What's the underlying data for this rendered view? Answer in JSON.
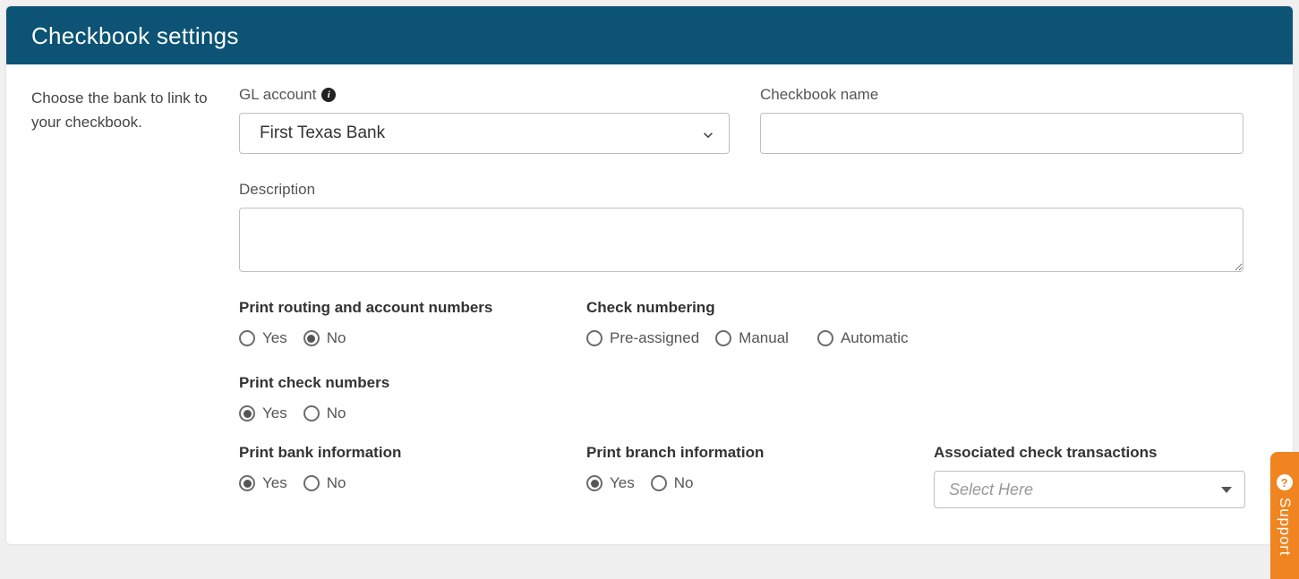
{
  "header": {
    "title": "Checkbook settings"
  },
  "left": {
    "instruction": "Choose the bank to link to your checkbook."
  },
  "fields": {
    "glAccount": {
      "label": "GL account",
      "selected": "First Texas Bank"
    },
    "checkbookName": {
      "label": "Checkbook name",
      "value": ""
    },
    "description": {
      "label": "Description",
      "value": ""
    },
    "printRouting": {
      "label": "Print routing and account numbers",
      "options": {
        "yes": "Yes",
        "no": "No"
      },
      "selected": "no"
    },
    "checkNumbering": {
      "label": "Check numbering",
      "options": {
        "pre": "Pre-assigned",
        "manual": "Manual",
        "auto": "Automatic"
      },
      "selected": ""
    },
    "printCheckNumbers": {
      "label": "Print check numbers",
      "options": {
        "yes": "Yes",
        "no": "No"
      },
      "selected": "yes"
    },
    "printBankInfo": {
      "label": "Print bank information",
      "options": {
        "yes": "Yes",
        "no": "No"
      },
      "selected": "yes"
    },
    "printBranchInfo": {
      "label": "Print branch information",
      "options": {
        "yes": "Yes",
        "no": "No"
      },
      "selected": "yes"
    },
    "assocTransactions": {
      "label": "Associated check transactions",
      "placeholder": "Select Here"
    }
  },
  "support": {
    "label": "Support"
  }
}
